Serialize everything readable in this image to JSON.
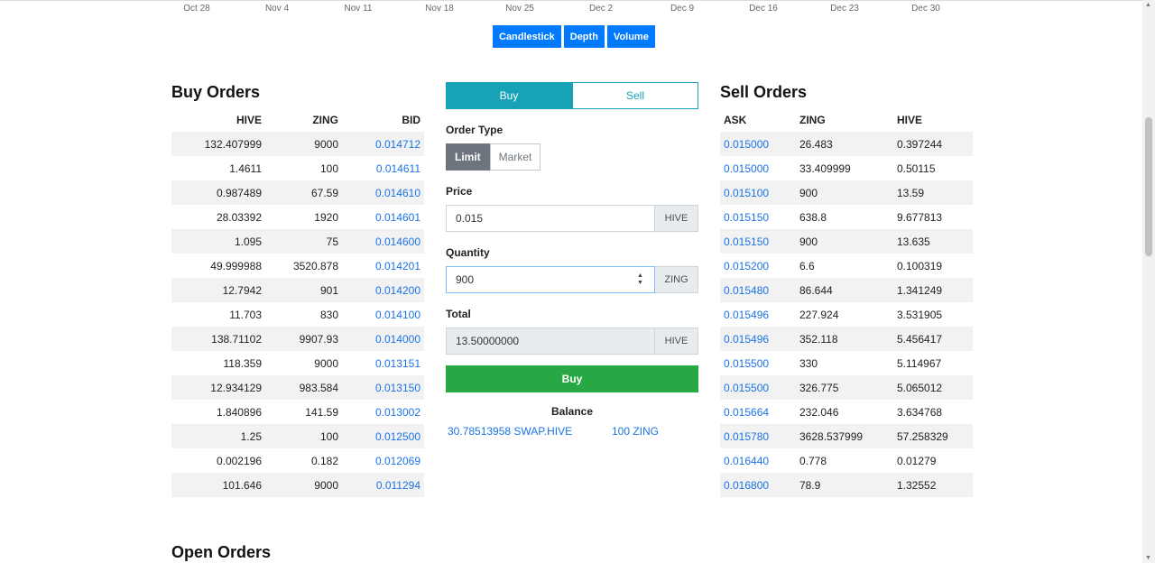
{
  "chart": {
    "dates": [
      "Oct 28",
      "Nov 4",
      "Nov 11",
      "Nov 18",
      "Nov 25",
      "Dec 2",
      "Dec 9",
      "Dec 16",
      "Dec 23",
      "Dec 30"
    ],
    "buttons": [
      "Candlestick",
      "Depth",
      "Volume"
    ]
  },
  "buy_orders": {
    "title": "Buy Orders",
    "headers": [
      "HIVE",
      "ZING",
      "BID"
    ],
    "rows": [
      [
        "132.407999",
        "9000",
        "0.014712"
      ],
      [
        "1.4611",
        "100",
        "0.014611"
      ],
      [
        "0.987489",
        "67.59",
        "0.014610"
      ],
      [
        "28.03392",
        "1920",
        "0.014601"
      ],
      [
        "1.095",
        "75",
        "0.014600"
      ],
      [
        "49.999988",
        "3520.878",
        "0.014201"
      ],
      [
        "12.7942",
        "901",
        "0.014200"
      ],
      [
        "11.703",
        "830",
        "0.014100"
      ],
      [
        "138.71102",
        "9907.93",
        "0.014000"
      ],
      [
        "118.359",
        "9000",
        "0.013151"
      ],
      [
        "12.934129",
        "983.584",
        "0.013150"
      ],
      [
        "1.840896",
        "141.59",
        "0.013002"
      ],
      [
        "1.25",
        "100",
        "0.012500"
      ],
      [
        "0.002196",
        "0.182",
        "0.012069"
      ],
      [
        "101.646",
        "9000",
        "0.011294"
      ]
    ]
  },
  "sell_orders": {
    "title": "Sell Orders",
    "headers": [
      "ASK",
      "ZING",
      "HIVE"
    ],
    "rows": [
      [
        "0.015000",
        "26.483",
        "0.397244"
      ],
      [
        "0.015000",
        "33.409999",
        "0.50115"
      ],
      [
        "0.015100",
        "900",
        "13.59"
      ],
      [
        "0.015150",
        "638.8",
        "9.677813"
      ],
      [
        "0.015150",
        "900",
        "13.635"
      ],
      [
        "0.015200",
        "6.6",
        "0.100319"
      ],
      [
        "0.015480",
        "86.644",
        "1.341249"
      ],
      [
        "0.015496",
        "227.924",
        "3.531905"
      ],
      [
        "0.015496",
        "352.118",
        "5.456417"
      ],
      [
        "0.015500",
        "330",
        "5.114967"
      ],
      [
        "0.015500",
        "326.775",
        "5.065012"
      ],
      [
        "0.015664",
        "232.046",
        "3.634768"
      ],
      [
        "0.015780",
        "3628.537999",
        "57.258329"
      ],
      [
        "0.016440",
        "0.778",
        "0.01279"
      ],
      [
        "0.016800",
        "78.9",
        "1.32552"
      ]
    ]
  },
  "form": {
    "tab_buy": "Buy",
    "tab_sell": "Sell",
    "order_type_label": "Order Type",
    "type_limit": "Limit",
    "type_market": "Market",
    "price_label": "Price",
    "price_value": "0.015",
    "price_unit": "HIVE",
    "quantity_label": "Quantity",
    "quantity_value": "900",
    "quantity_unit": "ZING",
    "total_label": "Total",
    "total_value": "13.50000000",
    "total_unit": "HIVE",
    "submit": "Buy",
    "balance_title": "Balance",
    "balance_hive": "30.78513958 SWAP.HIVE",
    "balance_zing": "100 ZING"
  },
  "open_orders": {
    "title": "Open Orders"
  },
  "colors": {
    "primary": "#007bff",
    "teal": "#17a2b8",
    "green": "#28a745",
    "link": "#1a73e8"
  }
}
